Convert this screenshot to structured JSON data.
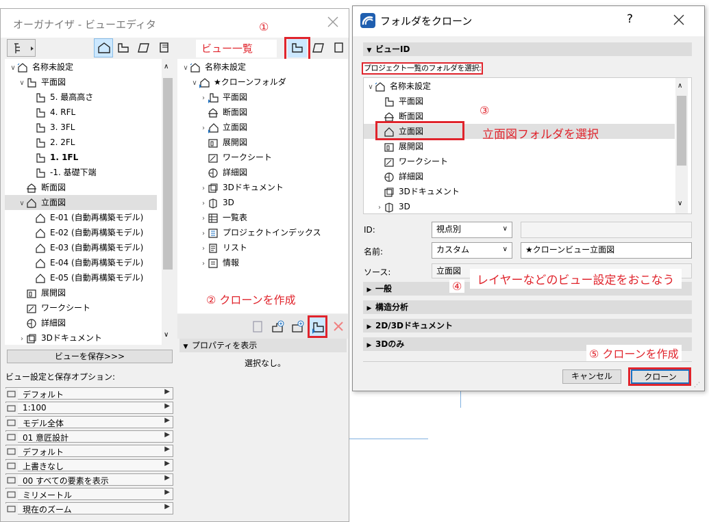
{
  "left_window": {
    "title": "オーガナイザ - ビューエディタ",
    "left_tree": [
      {
        "label": "名称未設定",
        "icon": "house-icon",
        "indent": 0,
        "chev": "down"
      },
      {
        "label": "平面図",
        "icon": "plan-icon",
        "indent": 1,
        "chev": "down"
      },
      {
        "label": "5. 最高高さ",
        "icon": "story-icon",
        "indent": 2,
        "chev": ""
      },
      {
        "label": "4. RFL",
        "icon": "story-icon",
        "indent": 2,
        "chev": ""
      },
      {
        "label": "3. 3FL",
        "icon": "story-icon",
        "indent": 2,
        "chev": ""
      },
      {
        "label": "2. 2FL",
        "icon": "story-icon",
        "indent": 2,
        "chev": ""
      },
      {
        "label": "1. 1FL",
        "icon": "story-icon",
        "indent": 2,
        "chev": "",
        "bold": true
      },
      {
        "label": "-1. 基礎下端",
        "icon": "story-icon",
        "indent": 2,
        "chev": ""
      },
      {
        "label": "断面図",
        "icon": "section-icon",
        "indent": 1,
        "chev": ""
      },
      {
        "label": "立面図",
        "icon": "elevation-icon",
        "indent": 1,
        "chev": "down",
        "selected": true
      },
      {
        "label": "E-01 (自動再構築モデル)",
        "icon": "elevation-icon",
        "indent": 2,
        "chev": ""
      },
      {
        "label": "E-02 (自動再構築モデル)",
        "icon": "elevation-icon",
        "indent": 2,
        "chev": ""
      },
      {
        "label": "E-03 (自動再構築モデル)",
        "icon": "elevation-icon",
        "indent": 2,
        "chev": ""
      },
      {
        "label": "E-04 (自動再構築モデル)",
        "icon": "elevation-icon",
        "indent": 2,
        "chev": ""
      },
      {
        "label": "E-05 (自動再構築モデル)",
        "icon": "elevation-icon",
        "indent": 2,
        "chev": ""
      },
      {
        "label": "展開図",
        "icon": "interior-icon",
        "indent": 1,
        "chev": ""
      },
      {
        "label": "ワークシート",
        "icon": "worksheet-icon",
        "indent": 1,
        "chev": ""
      },
      {
        "label": "詳細図",
        "icon": "detail-icon",
        "indent": 1,
        "chev": ""
      },
      {
        "label": "3Dドキュメント",
        "icon": "3d-doc-icon",
        "indent": 1,
        "chev": "right"
      }
    ],
    "save_view_button": "ビューを保存>>>",
    "view_settings_label": "ビュー設定と保存オプション:",
    "options": [
      {
        "value": "デフォルト",
        "icon": "layers-icon"
      },
      {
        "value": "1:100",
        "icon": "scale-icon"
      },
      {
        "value": "モデル全体",
        "icon": "structure-icon"
      },
      {
        "value": "01 意匠設計",
        "icon": "pen-icon"
      },
      {
        "value": "デフォルト",
        "icon": "model-view-icon"
      },
      {
        "value": "上書きなし",
        "icon": "override-icon"
      },
      {
        "value": "00 すべての要素を表示",
        "icon": "renovation-icon"
      },
      {
        "value": "ミリメートル",
        "icon": "dimension-icon"
      },
      {
        "value": "現在のズーム",
        "icon": "zoom-icon"
      }
    ],
    "right_tree": [
      {
        "label": "名称未設定",
        "icon": "house-icon",
        "indent": 0,
        "chev": "down"
      },
      {
        "label": "★クローンフォルダ",
        "icon": "house-clone-icon",
        "indent": 1,
        "chev": "down"
      },
      {
        "label": "平面図",
        "icon": "plan-clone-icon",
        "indent": 2,
        "chev": "right"
      },
      {
        "label": "断面図",
        "icon": "section-icon",
        "indent": 2,
        "chev": ""
      },
      {
        "label": "立面図",
        "icon": "elevation-clone-icon",
        "indent": 2,
        "chev": "right"
      },
      {
        "label": "展開図",
        "icon": "interior-icon",
        "indent": 2,
        "chev": ""
      },
      {
        "label": "ワークシート",
        "icon": "worksheet-icon",
        "indent": 2,
        "chev": ""
      },
      {
        "label": "詳細図",
        "icon": "detail-icon",
        "indent": 2,
        "chev": ""
      },
      {
        "label": "3Dドキュメント",
        "icon": "3d-doc-icon",
        "indent": 2,
        "chev": "right"
      },
      {
        "label": "3D",
        "icon": "3d-icon",
        "indent": 2,
        "chev": "right"
      },
      {
        "label": "一覧表",
        "icon": "schedule-icon",
        "indent": 2,
        "chev": "right"
      },
      {
        "label": "プロジェクトインデックス",
        "icon": "index-icon",
        "indent": 2,
        "chev": "right"
      },
      {
        "label": "リスト",
        "icon": "list-icon",
        "indent": 2,
        "chev": "right"
      },
      {
        "label": "情報",
        "icon": "info-icon",
        "indent": 2,
        "chev": "right"
      }
    ],
    "view_list_label": "ビュー一覧",
    "properties_header": "プロパティを表示",
    "no_selection": "選択なし。"
  },
  "annotations": {
    "a1": "①",
    "a2": "② クローンを作成",
    "a3": "③",
    "a3_text": "立面図フォルダを選択",
    "a4": "④",
    "a4_text": "レイヤーなどのビュー設定をおこなう",
    "a5": "⑤ クローンを作成"
  },
  "dialog": {
    "title": "フォルダをクローン",
    "help": "?",
    "view_id_section": "ビューID",
    "select_folder_label": "プロジェクト一覧のフォルダを選択:",
    "tree": [
      {
        "label": "名称未設定",
        "icon": "house-icon",
        "indent": 0,
        "chev": "down"
      },
      {
        "label": "平面図",
        "icon": "plan-icon",
        "indent": 1,
        "chev": ""
      },
      {
        "label": "断面図",
        "icon": "section-icon",
        "indent": 1,
        "chev": ""
      },
      {
        "label": "立面図",
        "icon": "elevation-icon",
        "indent": 1,
        "chev": "",
        "selected": true
      },
      {
        "label": "展開図",
        "icon": "interior-icon",
        "indent": 1,
        "chev": ""
      },
      {
        "label": "ワークシート",
        "icon": "worksheet-icon",
        "indent": 1,
        "chev": ""
      },
      {
        "label": "詳細図",
        "icon": "detail-icon",
        "indent": 1,
        "chev": ""
      },
      {
        "label": "3Dドキュメント",
        "icon": "3d-doc-icon",
        "indent": 1,
        "chev": ""
      },
      {
        "label": "3D",
        "icon": "3d-icon",
        "indent": 1,
        "chev": "right"
      }
    ],
    "id_label": "ID:",
    "id_select": "視点別",
    "id_value": "",
    "name_label": "名前:",
    "name_select": "カスタム",
    "name_value": "★クローンビュー立面図",
    "source_label": "ソース:",
    "source_value": "立面図",
    "sections": [
      "一般",
      "構造分析",
      "2D/3Dドキュメント",
      "3Dのみ"
    ],
    "cancel": "キャンセル",
    "clone": "クローン"
  },
  "colors": {
    "accent_red": "#e0242c",
    "selection": "#cce8ff",
    "section_bar": "#dcdcdc"
  }
}
